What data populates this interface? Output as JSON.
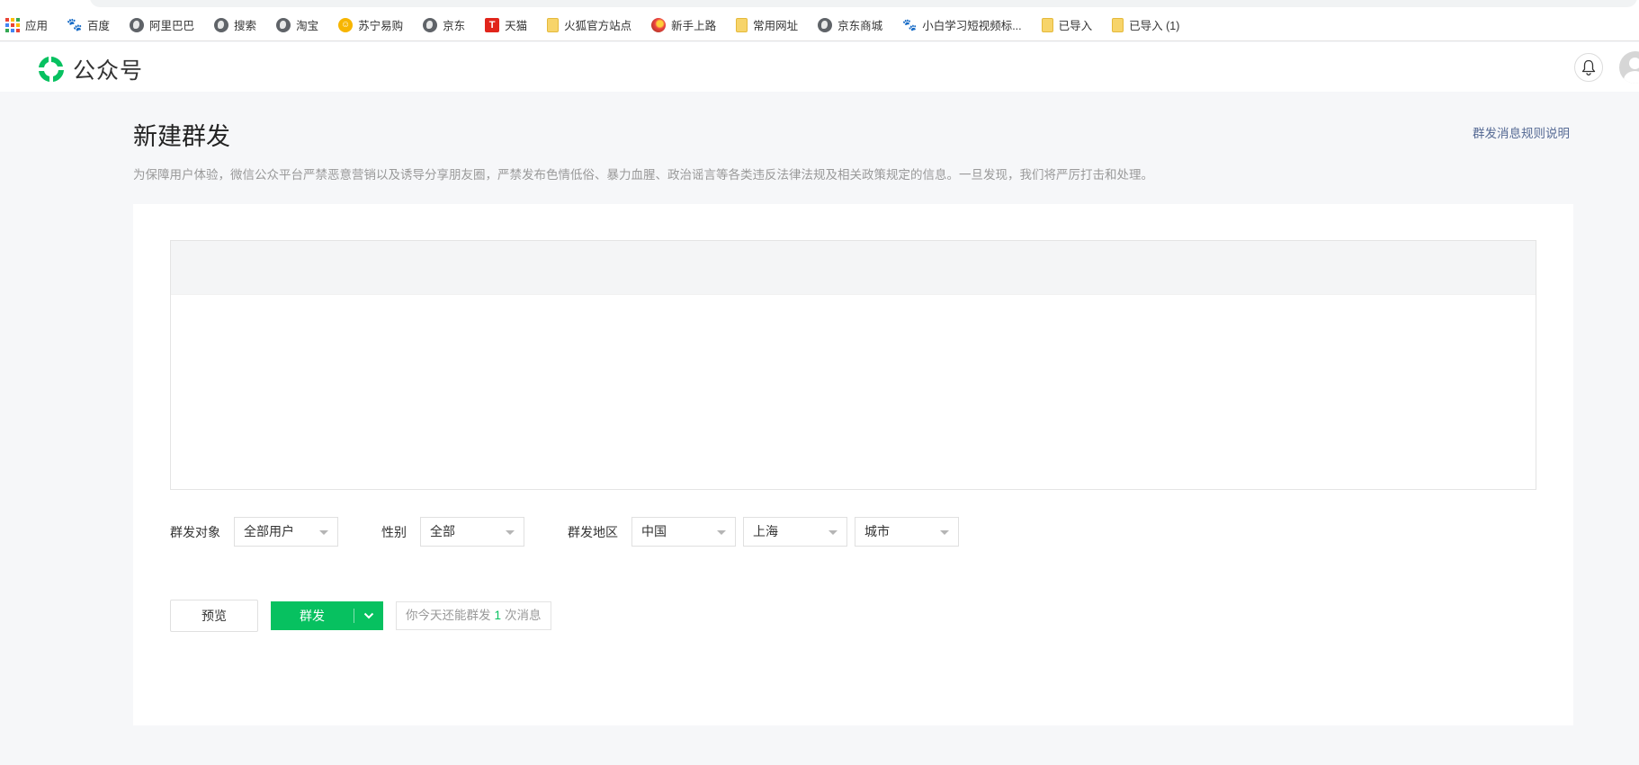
{
  "bookmarks": [
    {
      "label": "应用",
      "icon": "apps-grid-icon"
    },
    {
      "label": "百度",
      "icon": "baidu-paw-icon"
    },
    {
      "label": "阿里巴巴",
      "icon": "globe-icon"
    },
    {
      "label": "搜索",
      "icon": "globe-icon"
    },
    {
      "label": "淘宝",
      "icon": "globe-icon"
    },
    {
      "label": "苏宁易购",
      "icon": "suning-icon"
    },
    {
      "label": "京东",
      "icon": "globe-icon"
    },
    {
      "label": "天猫",
      "icon": "tmall-icon"
    },
    {
      "label": "火狐官方站点",
      "icon": "folder-icon"
    },
    {
      "label": "新手上路",
      "icon": "firefox-icon"
    },
    {
      "label": "常用网址",
      "icon": "folder-icon"
    },
    {
      "label": "京东商城",
      "icon": "globe-icon"
    },
    {
      "label": "小白学习短视频标...",
      "icon": "paw-icon"
    },
    {
      "label": "已导入",
      "icon": "folder-icon"
    },
    {
      "label": "已导入 (1)",
      "icon": "folder-icon"
    }
  ],
  "header": {
    "logo_text": "公众号",
    "brand_color": "#07c160"
  },
  "page": {
    "title": "新建群发",
    "rules_link": "群发消息规则说明",
    "notice": "为保障用户体验，微信公众平台严禁恶意营销以及诱导分享朋友圈，严禁发布色情低俗、暴力血腥、政治谣言等各类违反法律法规及相关政策规定的信息。一旦发现，我们将严厉打击和处理。"
  },
  "filters": {
    "target_label": "群发对象",
    "target_value": "全部用户",
    "gender_label": "性别",
    "gender_value": "全部",
    "region_label": "群发地区",
    "country_value": "中国",
    "province_value": "上海",
    "city_value": "城市"
  },
  "actions": {
    "preview_label": "预览",
    "send_label": "群发",
    "quota_prefix": "你今天还能群发",
    "quota_count": "1",
    "quota_suffix": "次消息"
  }
}
